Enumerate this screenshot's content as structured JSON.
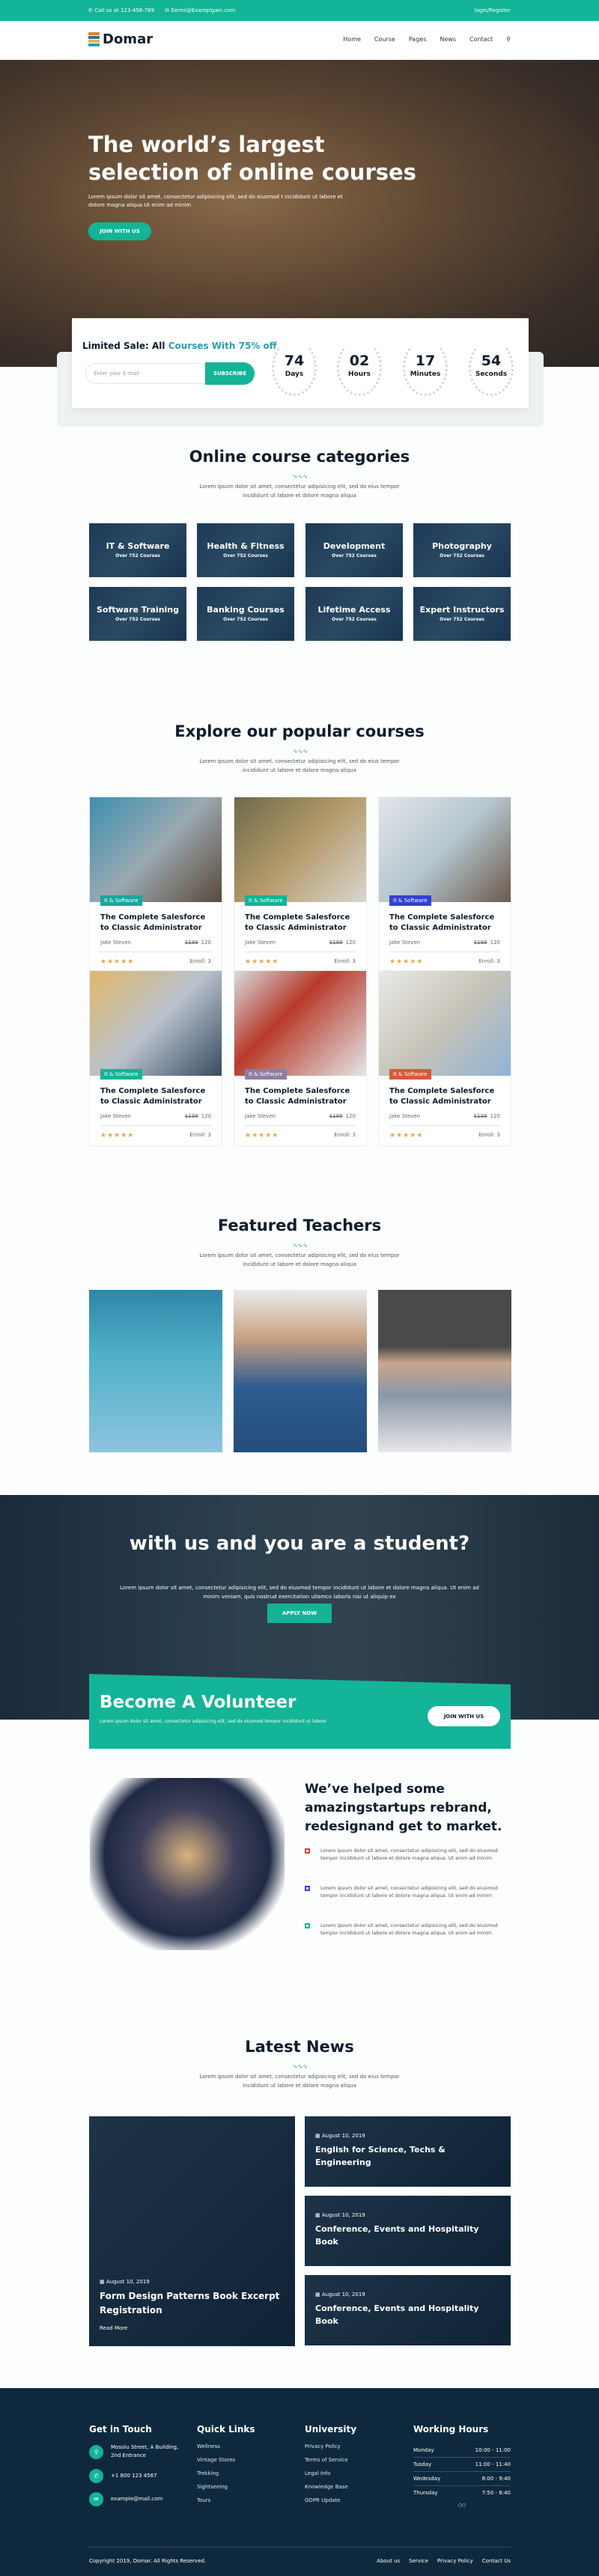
{
  "topbar": {
    "phone": "Call us at 123-456-789",
    "email": "Demo@Examplgain.com",
    "auth": "login/Register"
  },
  "nav": {
    "brand": "Domar",
    "items": [
      "Home",
      "Course",
      "Pages",
      "News",
      "Contact"
    ]
  },
  "hero": {
    "title": "The world’s largest selection of online courses",
    "text": "Lorem ipsum dolor sit amet, consectetur adipisicing elit, sed do eiusmod t incididunt ut labore et dolore magna aliqua Ut enim ad minim",
    "button": "JOIN WITH US"
  },
  "sale": {
    "prefix": "Limited Sale: All ",
    "highlight": "Courses With 75% off",
    "email_placeholder": "Enter your E-mail",
    "subscribe": "SUBSCRIBE",
    "countdown": [
      {
        "n": "74",
        "l": "Days"
      },
      {
        "n": "02",
        "l": "Hours"
      },
      {
        "n": "17",
        "l": "Minutes"
      },
      {
        "n": "54",
        "l": "Seconds"
      }
    ]
  },
  "categories": {
    "title": "Online course categories",
    "desc": "Lorem ipsum dolor sit amet, consectetur adipisicing elit, sed do eius tempor incididunt ut labore et dolore magna aliqua",
    "items": [
      {
        "name": "IT & Software",
        "count": "Over 752 Courses"
      },
      {
        "name": "Health & Fitness",
        "count": "Over 752 Courses"
      },
      {
        "name": "Development",
        "count": "Over 752 Courses"
      },
      {
        "name": "Photography",
        "count": "Over 752 Courses"
      },
      {
        "name": "Software Training",
        "count": "Over 752 Courses"
      },
      {
        "name": "Banking Courses",
        "count": "Over 752 Courses"
      },
      {
        "name": "Lifetime Access",
        "count": "Over 752 Courses"
      },
      {
        "name": "Expert Instructors",
        "count": "Over 752 Courses"
      }
    ]
  },
  "courses": {
    "title": "Explore our popular courses",
    "desc": "Lorem ipsum dolor sit amet, consectetur adipisicing elit, sed do eius tempor incididunt ut labore et dolore magna aliqua",
    "items": [
      {
        "badge": "It & Software",
        "badge_color": "#1aa69b",
        "title": "The Complete Salesforce to Classic Administrator",
        "author": "Jake Steven",
        "old_price": "$199",
        "price": "120",
        "rating": 5,
        "enroll": "Enroll: 3"
      },
      {
        "badge": "It & Software",
        "badge_color": "#13b497",
        "title": "The Complete Salesforce to Classic Administrator",
        "author": "Jake Steven",
        "old_price": "$199",
        "price": "120",
        "rating": 5,
        "enroll": "Enroll: 3"
      },
      {
        "badge": "It & Software",
        "badge_color": "#3440d0",
        "title": "The Complete Salesforce to Classic Administrator",
        "author": "Jake Steven",
        "old_price": "$199",
        "price": "120",
        "rating": 5,
        "enroll": "Enroll: 3"
      },
      {
        "badge": "It & Software",
        "badge_color": "#13b497",
        "title": "The Complete Salesforce to Classic Administrator",
        "author": "Jake Steven",
        "old_price": "$199",
        "price": "120",
        "rating": 5,
        "enroll": "Enroll: 3"
      },
      {
        "badge": "It & Software",
        "badge_color": "#8d7ea3",
        "title": "The Complete Salesforce to Classic Administrator",
        "author": "Jake Steven",
        "old_price": "$199",
        "price": "120",
        "rating": 5,
        "enroll": "Enroll: 3"
      },
      {
        "badge": "It & Software",
        "badge_color": "#d65a3a",
        "title": "The Complete Salesforce to Classic Administrator",
        "author": "Jake Steven",
        "old_price": "$199",
        "price": "120",
        "rating": 5,
        "enroll": "Enroll: 3"
      }
    ]
  },
  "teachers": {
    "title": "Featured Teachers",
    "desc": "Lorem ipsum dolor sit amet, consectetur adipisicing elit, sed do eius tempor incididunt ut labore et dolore magna aliqua"
  },
  "cta": {
    "title": "with us and you are a student?",
    "text": "Lorem ipsum dolor sit amet, consectetur adipisicing elit, sed do eiusmod tempor incididunt ut labore et dolore magna aliqua. Ut enim ad minim veniam, quis nostrud exercitation ullamco laboris nisi ut aliquip ex",
    "button": "APPLY NOW"
  },
  "volunteer": {
    "title": "Become A Volunteer",
    "text": "Lorem ipsum dolor sit amet, consectetur adipisicing elit, sed do eiusmod tempor incididunt ut labore",
    "button": "JOIN WITH US"
  },
  "helped": {
    "title": "We’ve helped some amazingstartups rebrand, redesignand get to market.",
    "points": [
      {
        "color": "#d0463a",
        "text": "Lorem ipsum dolor sit amet, consectetur adipisicing elit, sed do eiusmod tempor incididunt ut labore et dolore magna aliqua. Ut enim ad minim"
      },
      {
        "color": "#3440d0",
        "text": "Lorem ipsum dolor sit amet, consectetur adipisicing elit, sed do eiusmod tempor incididunt ut labore et dolore magna aliqua. Ut enim ad minim"
      },
      {
        "color": "#13b497",
        "text": "Lorem ipsum dolor sit amet, consectetur adipisicing elit, sed do eiusmod tempor incididunt ut labore et dolore magna aliqua. Ut enim ad minim"
      }
    ]
  },
  "news": {
    "title": "Latest News",
    "desc": "Lorem ipsum dolor sit amet, consectetur adipisicing elit, sed do eius tempor incididunt ut labore et dolore magna aliqua",
    "featured": {
      "date": "August 10, 2019",
      "title": "Form Design Patterns Book Excerpt Registration",
      "read_more": "Read More"
    },
    "items": [
      {
        "date": "August 10, 2019",
        "title": "English for Science, Techs & Engineering"
      },
      {
        "date": "August 10, 2019",
        "title": "Conference, Events and Hospitality Book"
      },
      {
        "date": "August 10, 2019",
        "title": "Conference, Events and Hospitality Book"
      }
    ]
  },
  "footer": {
    "contact_title": "Get in Touch",
    "address": "Mosoiu Street, A Building, 2nd Entrance",
    "phone": "+1 800 123 4567",
    "email": "example@mail.com",
    "quick_title": "Quick Links",
    "quick": [
      "Wellness",
      "Vintage Stores",
      "Trekking",
      "Sightseeing",
      "Tours"
    ],
    "uni_title": "University",
    "uni": [
      "Privacy Policy",
      "Terms of Service",
      "Legal Info",
      "Knowledge Base",
      "GDPR Update"
    ],
    "hours_title": "Working Hours",
    "hours": [
      {
        "day": "Monday",
        "time": "10:00 - 11:00"
      },
      {
        "day": "Tusday",
        "time": "11:00 - 11:40"
      },
      {
        "day": "Wedesday",
        "time": "8:00 - 9:40"
      },
      {
        "day": "Thursday",
        "time": "7:50 - 8:40"
      }
    ],
    "copyright": "Copyright 2019, Domar. All Rights Reserved.",
    "bottom_links": [
      "About us",
      "Service",
      "Privacy Policy",
      "Contact Us"
    ]
  }
}
